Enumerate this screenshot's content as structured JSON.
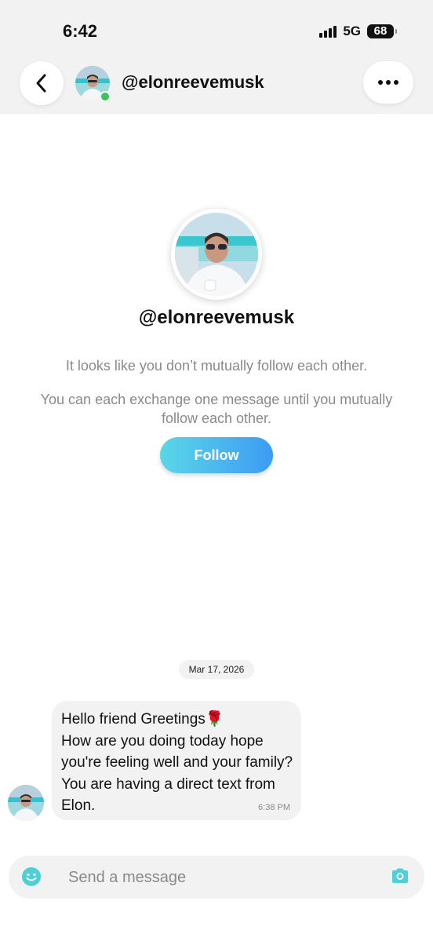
{
  "status_bar": {
    "time": "6:42",
    "network": "5G",
    "battery": "68"
  },
  "header": {
    "username": "@elonreevemusk",
    "back_icon": "chevron-left-icon",
    "more_icon": "more-horizontal-icon",
    "online": true
  },
  "profile": {
    "username": "@elonreevemusk",
    "mutual_notice": "It looks like you don’t mutually follow each other.",
    "exchange_notice": "You can each exchange one message until you mutually follow each other.",
    "follow_label": "Follow"
  },
  "chat": {
    "date": "Mar 17, 2026",
    "message": {
      "text": "Hello friend Greetings🌹\nHow are you doing today hope you're feeling well and your family? You are having a direct text from Elon.",
      "time": "6:38 PM"
    }
  },
  "composer": {
    "placeholder": "Send a message",
    "emoji_icon": "smiley-icon",
    "camera_icon": "camera-icon"
  },
  "colors": {
    "accent_start": "#5ad7e6",
    "accent_end": "#3d9bf5",
    "icon_teal": "#4fd0d8",
    "online": "#3bc45a"
  }
}
